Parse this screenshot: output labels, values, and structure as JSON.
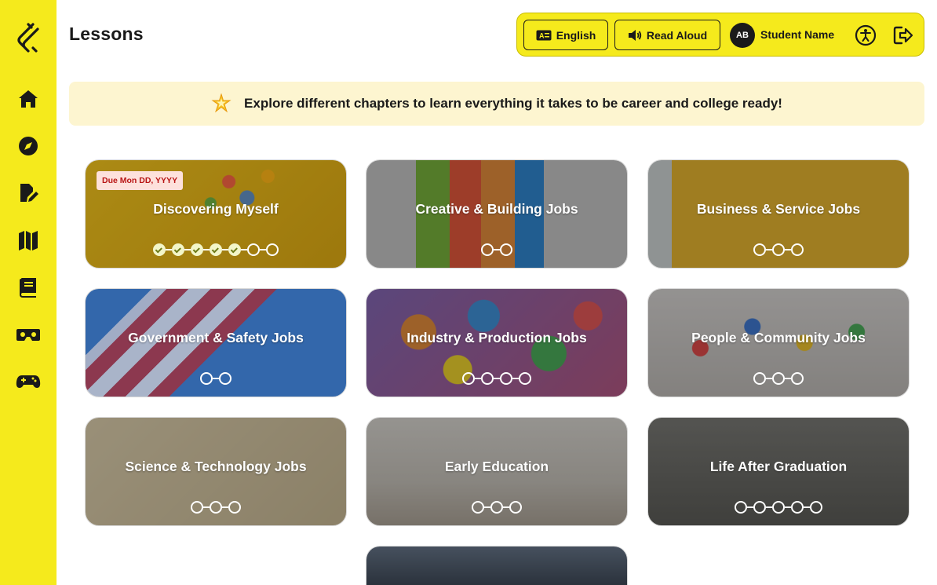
{
  "header": {
    "title": "Lessons",
    "language_label": "English",
    "read_aloud_label": "Read Aloud",
    "avatar_initials": "AB",
    "student_name": "Student Name"
  },
  "sidebar": {
    "items": [
      {
        "icon": "home-icon"
      },
      {
        "icon": "compass-icon"
      },
      {
        "icon": "edit-document-icon"
      },
      {
        "icon": "map-icon"
      },
      {
        "icon": "book-icon"
      },
      {
        "icon": "vr-headset-icon"
      },
      {
        "icon": "gamepad-icon"
      }
    ]
  },
  "banner": {
    "text": "Explore different chapters to learn everything it takes to be career and college ready!",
    "icon": "star-icon"
  },
  "lessons": [
    {
      "title": "Discovering Myself",
      "due": "Due Mon DD, YYYY",
      "completed": 5,
      "total": 7
    },
    {
      "title": "Creative & Building Jobs",
      "completed": 0,
      "total": 2
    },
    {
      "title": "Business & Service Jobs",
      "completed": 0,
      "total": 3
    },
    {
      "title": "Government & Safety Jobs",
      "completed": 0,
      "total": 2
    },
    {
      "title": "Industry & Production Jobs",
      "completed": 0,
      "total": 4
    },
    {
      "title": "People & Community Jobs",
      "completed": 0,
      "total": 3
    },
    {
      "title": "Science & Technology Jobs",
      "completed": 0,
      "total": 3
    },
    {
      "title": "Early Education",
      "completed": 0,
      "total": 3
    },
    {
      "title": "Life After Graduation",
      "completed": 0,
      "total": 5
    },
    {
      "title": "",
      "completed": 0,
      "total": 0
    }
  ],
  "colors": {
    "accent": "#f5ea1c",
    "banner_bg": "#fdf5d0",
    "due_badge_bg": "#fde1dc",
    "due_badge_text": "#b81414"
  }
}
